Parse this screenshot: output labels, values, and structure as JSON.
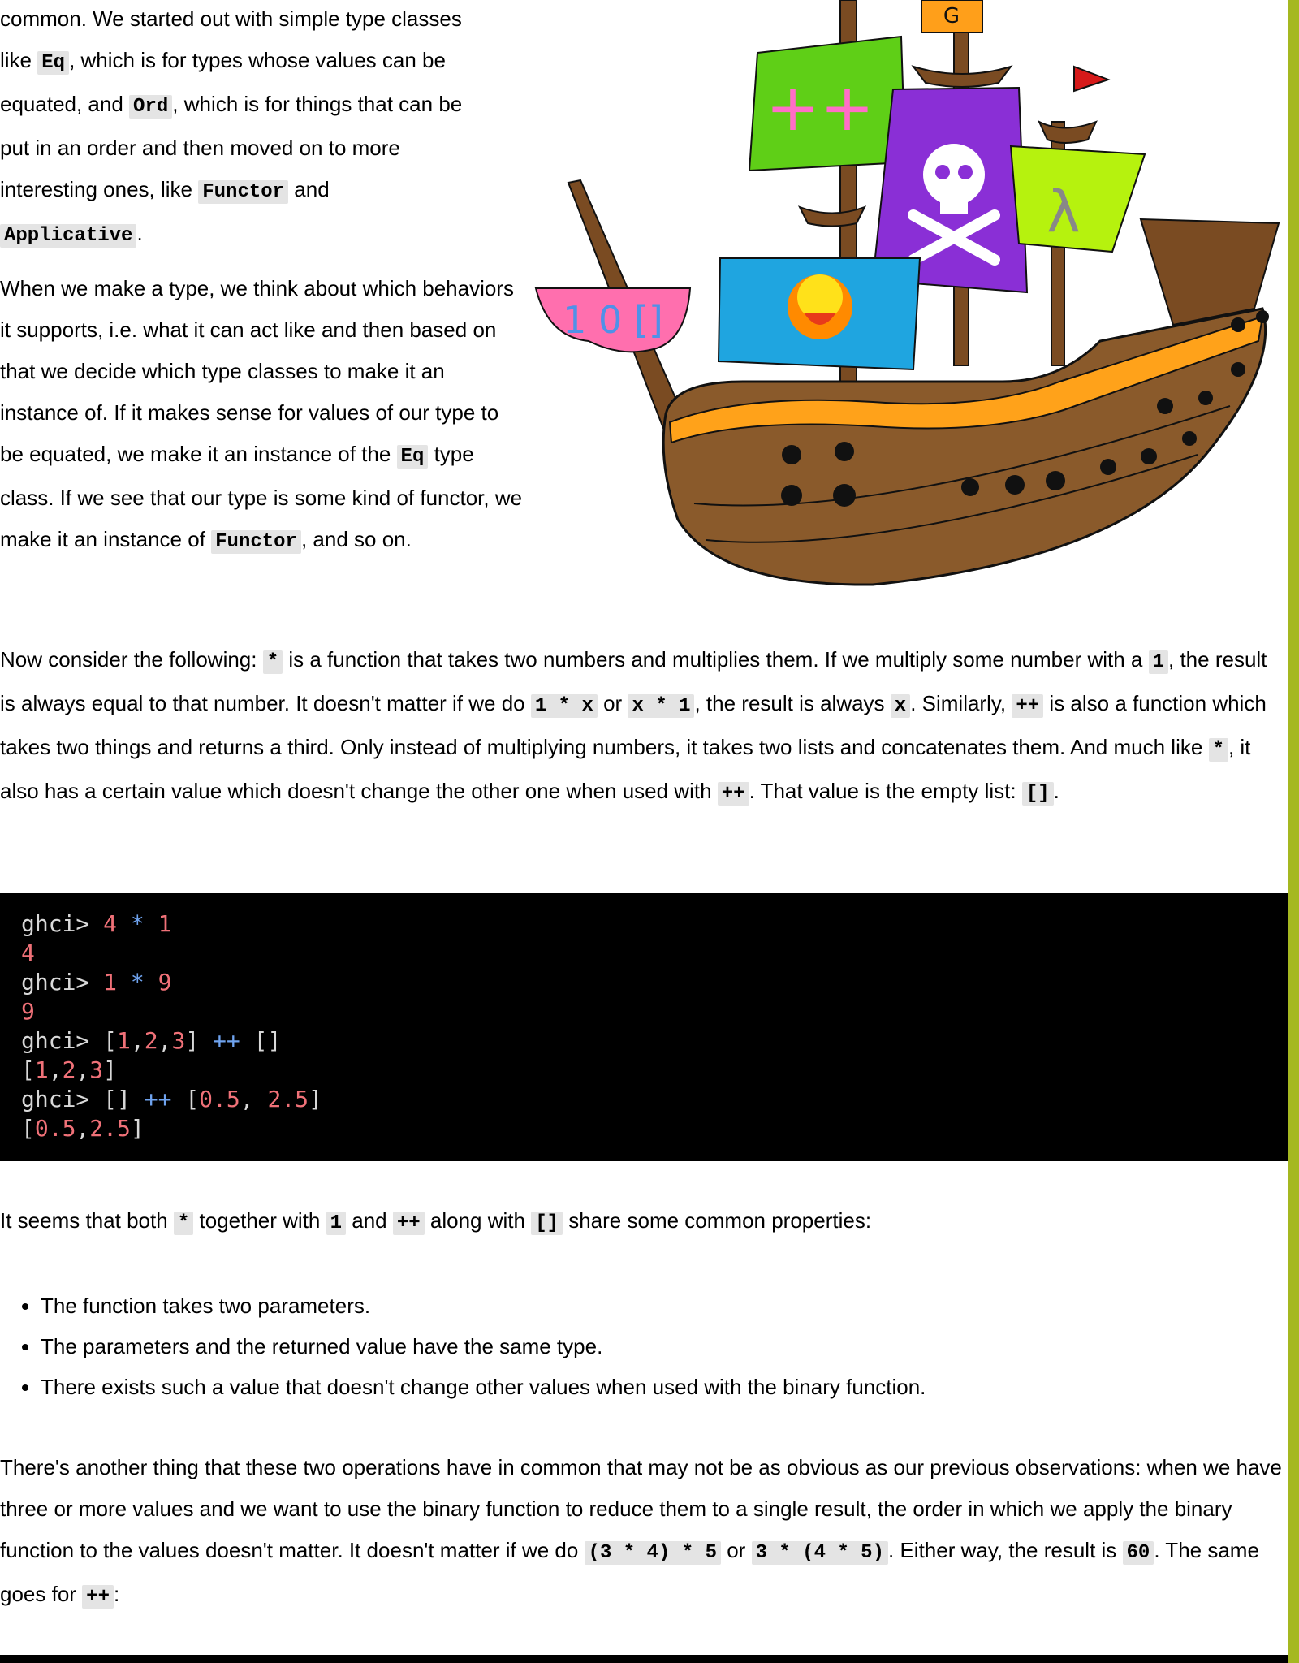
{
  "intro": {
    "l1": "common. We started out with simple type classes",
    "l2a": "like ",
    "c_eq": "Eq",
    "l2b": ", which is for types whose values can be",
    "l3a": "equated, and ",
    "c_ord": "Ord",
    "l3b": ", which is for things that can be",
    "l4": "put in an order and then moved on to more",
    "l5a": "interesting ones, like ",
    "c_functor": "Functor",
    "l5b": " and",
    "c_applicative": "Applicative",
    "l6b": "."
  },
  "p1": {
    "t1": "When we make a type, we think about which behaviors it supports, i.e. what it can act like and then based on that we decide which type classes to make it an instance of. If it makes sense for values of our type to be equated, we make it an instance of the ",
    "c_eq": "Eq",
    "t2": " type class. If we see that our type is some kind of functor, we make it an instance of ",
    "c_functor": "Functor",
    "t3": ", and so on."
  },
  "ship": {
    "flag_letter": "G",
    "green_sail": "++",
    "lime_sail": "λ",
    "pink_text": "1 0 []"
  },
  "p2": {
    "t1": "Now consider the following: ",
    "c1": "*",
    "t2": " is a function that takes two numbers and multiplies them. If we multiply some number with a ",
    "c2": "1",
    "t3": ", the result is always equal to that number. It doesn't matter if we do ",
    "c3": "1 * x",
    "t4": " or ",
    "c4": "x * 1",
    "t5": ", the result is always ",
    "c5": "x",
    "t6": ". Similarly, ",
    "c6": "++",
    "t7": " is also a function which takes two things and returns a third. Only instead of multiplying numbers, it takes two lists and concatenates them. And much like ",
    "c7": "*",
    "t8": ", it also has a certain value which doesn't change the other one when used with ",
    "c8": "++",
    "t9": ". That value is the empty list: ",
    "c9": "[]",
    "t10": "."
  },
  "ghci": {
    "prompt": "ghci> ",
    "l1a": "4",
    "l1op": " * ",
    "l1b": "1",
    "r1": "4",
    "l2a": "1",
    "l2op": " * ",
    "l2b": "9",
    "r2": "9",
    "l3_open": "[",
    "l3_n1": "1",
    "l3_c1": ",",
    "l3_n2": "2",
    "l3_c2": ",",
    "l3_n3": "3",
    "l3_close": "]",
    "l3_op": " ++ ",
    "l3_empty": "[]",
    "r3_open": "[",
    "r3_n1": "1",
    "r3_c1": ",",
    "r3_n2": "2",
    "r3_c2": ",",
    "r3_n3": "3",
    "r3_close": "]",
    "l4_empty": "[]",
    "l4_op": " ++ ",
    "l4_open": "[",
    "l4_n1": "0.5",
    "l4_c": ", ",
    "l4_n2": "2.5",
    "l4_close": "]",
    "r4_open": "[",
    "r4_n1": "0.5",
    "r4_c": ",",
    "r4_n2": "2.5",
    "r4_close": "]"
  },
  "p3": {
    "t1": "It seems that both ",
    "c1": "*",
    "t2": " together with ",
    "c2": "1",
    "t3": " and ",
    "c3": "++",
    "t4": " along with ",
    "c4": "[]",
    "t5": " share some common properties:"
  },
  "props": [
    "The function takes two parameters.",
    "The parameters and the returned value have the same type.",
    "There exists such a value that doesn't change other values when used with the binary function."
  ],
  "p4": {
    "t1": "There's another thing that these two operations have in common that may not be as obvious as our previous observations: when we have three or more values and we want to use the binary function to reduce them to a single result, the order in which we apply the binary function to the values doesn't matter. It doesn't matter if we do ",
    "c1": "(3 * 4) * 5",
    "t2": " or ",
    "c2": "3 * (4 * 5)",
    "t3": ". Either way, the result is ",
    "c3": "60",
    "t4": ". The same goes for ",
    "c4": "++",
    "t5": ":"
  }
}
